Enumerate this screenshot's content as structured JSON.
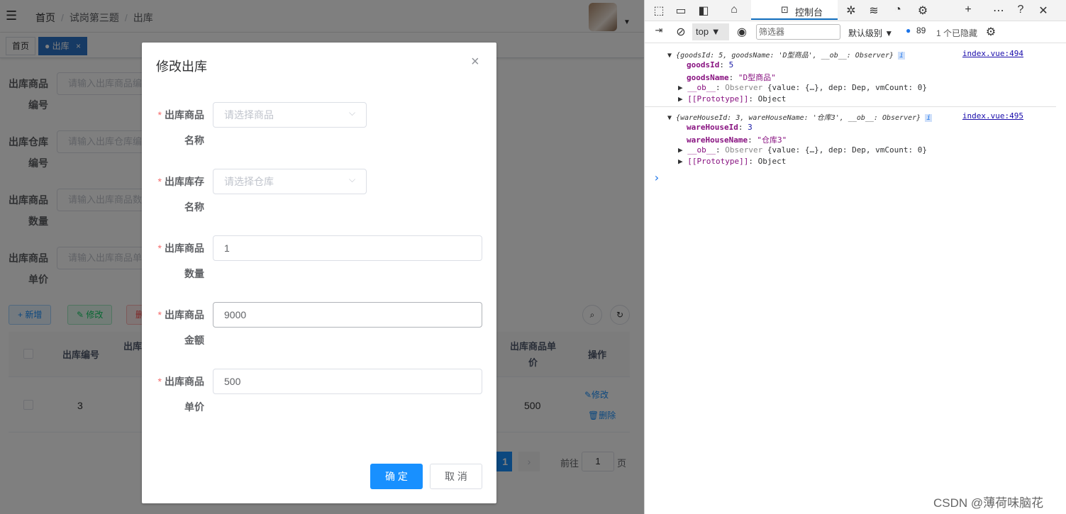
{
  "app": {
    "breadcrumb": [
      "首页",
      "试岗第三题",
      "出库"
    ],
    "tags": [
      {
        "label": "首页"
      },
      {
        "label": "出库",
        "close": "×"
      }
    ],
    "search_form": [
      {
        "label_1": "出库商品",
        "label_2": "编号",
        "placeholder": "请输入出库商品编号"
      },
      {
        "label_1": "出库仓库",
        "label_2": "编号",
        "placeholder": "请输入出库仓库编号"
      },
      {
        "label_1": "出库商品",
        "label_2": "数量",
        "placeholder": "请输入出库商品数量"
      },
      {
        "label_1": "出库商品",
        "label_2": "单价",
        "placeholder": "请输入出库商品单价"
      }
    ],
    "toolbar": {
      "add": "+ 新增",
      "edit": "✎ 修改",
      "delete": "删除"
    },
    "table": {
      "headers": {
        "id": "出库编号",
        "goods": "出库",
        "price_1": "出库商品单",
        "price_2": "价",
        "ops": "操作"
      },
      "rows": [
        {
          "id": "3",
          "price": "500",
          "edit": "✎修改",
          "delete": "删除"
        }
      ]
    },
    "pagination": {
      "current": "1",
      "goto": "前往",
      "page_input": "1",
      "page_unit": "页"
    }
  },
  "dialog": {
    "title": "修改出库",
    "close": "×",
    "fields": [
      {
        "label_1": "出库商品",
        "label_2": "名称",
        "placeholder": "请选择商品",
        "value": "",
        "type": "select"
      },
      {
        "label_1": "出库库存",
        "label_2": "名称",
        "placeholder": "请选择仓库",
        "value": "",
        "type": "select"
      },
      {
        "label_1": "出库商品",
        "label_2": "数量",
        "value": "1"
      },
      {
        "label_1": "出库商品",
        "label_2": "金额",
        "value": "9000"
      },
      {
        "label_1": "出库商品",
        "label_2": "单价",
        "value": "500"
      }
    ],
    "confirm": "确 定",
    "cancel": "取 消"
  },
  "devtools": {
    "tabs": {
      "console": "控制台"
    },
    "toolbar": {
      "context": "top",
      "filter_placeholder": "筛选器",
      "level": "默认级别",
      "message_count": "89",
      "hidden": "1 个已隐藏"
    },
    "logs": [
      {
        "summary": "{goodsId: 5, goodsName: 'D型商品', __ob__: Observer}",
        "source": "index.vue:494",
        "props": [
          {
            "k": "goodsId",
            "v": "5"
          },
          {
            "k": "goodsName",
            "v": "\"D型商品\""
          }
        ]
      },
      {
        "summary": "{wareHouseId: 3, wareHouseName: '仓库3', __ob__: Observer}",
        "source": "index.vue:495",
        "props": [
          {
            "k": "wareHouseId",
            "v": "3"
          },
          {
            "k": "wareHouseName",
            "v": "\"仓库3\""
          }
        ]
      }
    ],
    "ob_line": {
      "k": "__ob__",
      "type": "Observer",
      "v": "{value: {…}, dep: Dep, vmCount: 0}"
    },
    "proto_line": {
      "k": "[[Prototype]]",
      "v": "Object"
    },
    "prompt": "›"
  },
  "watermark": "CSDN @薄荷味脑花",
  "colors": {
    "primary": "#1890ff",
    "tag_active": "#2c74c9",
    "required": "#f56c6c"
  }
}
